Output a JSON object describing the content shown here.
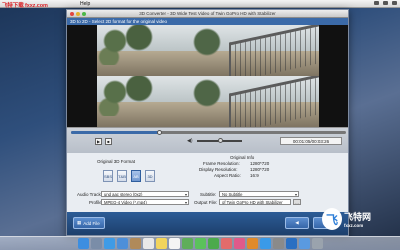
{
  "brand": {
    "text": "飞特下载 fxxz.com"
  },
  "menubar": {
    "app_menu": "Help",
    "status_icons": [
      "wifi-icon",
      "volume-icon",
      "battery-icon"
    ]
  },
  "window": {
    "title": "3D Converter - 3D Wide Test Video of Twin GoPro HD with Stabilizer",
    "step_label": "3D to 2D - Select 2D format for the original video"
  },
  "player": {
    "time_display": "00:01:05/00:03:26",
    "progress": 0.32,
    "volume": 0.5,
    "play_icon": "play-icon",
    "stop_icon": "stop-icon",
    "volume_icon": "speaker-icon"
  },
  "settings": {
    "original_3d_format_label": "Original 3D Format",
    "format_buttons": [
      "SBS",
      "T&B",
      "AB",
      "3D"
    ],
    "original_info_label": "Original Info",
    "frame_resolution_label": "Frame Resolution:",
    "frame_resolution": "1280*720",
    "display_resolution_label": "Display Resolution:",
    "display_resolution": "1280*720",
    "aspect_ratio_label": "Aspect Ratio:",
    "aspect_ratio": "16:9",
    "audio_track_label": "Audio Track:",
    "audio_track_value": "und aac stereo (0x2)",
    "subtitle_label": "Subtitle:",
    "subtitle_value": "No Subtitle",
    "profile_label": "Profile:",
    "profile_value": "MPEG-4 Video (*.mp4)",
    "output_file_label": "Output File:",
    "output_file_value": "of Twin GoPro HD with Stabilizer"
  },
  "footer": {
    "add_file_label": "Add File",
    "back_label": "Back",
    "next_label": "Next"
  },
  "watermark": {
    "mark": "飞",
    "cn": "飞特网",
    "url": "fxxz.com"
  },
  "dock": {
    "items": [
      "finder-icon",
      "launchpad-icon",
      "safari-icon",
      "mail-icon",
      "contacts-icon",
      "calendar-icon",
      "notes-icon",
      "reminders-icon",
      "maps-icon",
      "messages-icon",
      "facetime-icon",
      "photos-icon",
      "music-icon",
      "books-icon",
      "appstore-icon",
      "preferences-icon",
      "video-icon",
      "folder-icon",
      "trash-icon"
    ],
    "colors": [
      "#3d8ee0",
      "#7a8da8",
      "#3f9be6",
      "#4d8fd9",
      "#b08a5a",
      "#e8e8e8",
      "#f2d45c",
      "#f4f4f4",
      "#5fae5a",
      "#5bc25b",
      "#4caa4c",
      "#e36b6b",
      "#e05a8a",
      "#e08a2a",
      "#3a9ae8",
      "#8a8a8a",
      "#2a6fc2",
      "#5a9ae0",
      "#9aa3ad"
    ]
  },
  "colors": {
    "accent": "#3b6aa8",
    "footer": "#1d3f6c"
  }
}
